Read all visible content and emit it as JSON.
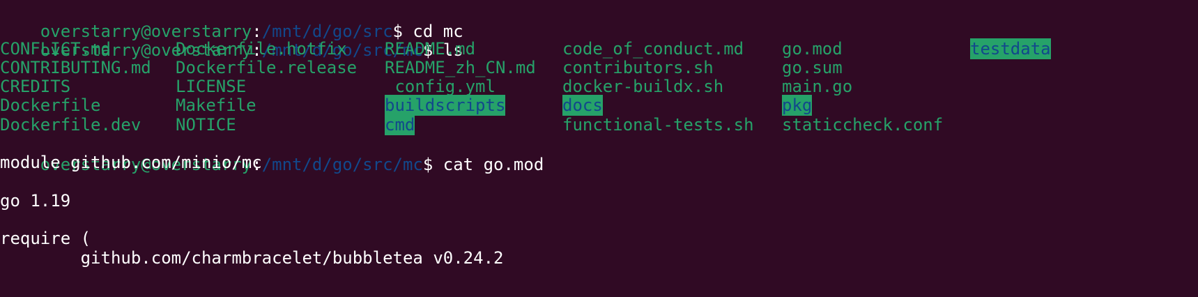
{
  "prompt": {
    "user_host": "overstarry@overstarry",
    "separator": ":",
    "dollar": "$"
  },
  "commands": [
    {
      "path": "/mnt/d/go/src",
      "command": " cd mc"
    },
    {
      "path": "/mnt/d/go/src/mc",
      "command": " ls"
    },
    {
      "path": "/mnt/d/go/src/mc",
      "command": " cat go.mod"
    }
  ],
  "ls_columns": [
    {
      "items": [
        {
          "name": "CONFLICT.md",
          "type": "file"
        },
        {
          "name": "CONTRIBUTING.md",
          "type": "file"
        },
        {
          "name": "CREDITS",
          "type": "file"
        },
        {
          "name": "Dockerfile",
          "type": "file"
        },
        {
          "name": "Dockerfile.dev",
          "type": "file"
        }
      ]
    },
    {
      "items": [
        {
          "name": "Dockerfile.hotfix",
          "type": "file"
        },
        {
          "name": "Dockerfile.release",
          "type": "file"
        },
        {
          "name": "LICENSE",
          "type": "file"
        },
        {
          "name": "Makefile",
          "type": "file"
        },
        {
          "name": "NOTICE",
          "type": "file"
        }
      ]
    },
    {
      "items": [
        {
          "name": "README.md",
          "type": "file"
        },
        {
          "name": "README_zh_CN.md",
          "type": "file"
        },
        {
          "name": "_config.yml",
          "type": "file"
        },
        {
          "name": "buildscripts",
          "type": "dir"
        },
        {
          "name": "cmd",
          "type": "dir"
        }
      ]
    },
    {
      "items": [
        {
          "name": "code_of_conduct.md",
          "type": "file"
        },
        {
          "name": "contributors.sh",
          "type": "file"
        },
        {
          "name": "docker-buildx.sh",
          "type": "file"
        },
        {
          "name": "docs",
          "type": "dir"
        },
        {
          "name": "functional-tests.sh",
          "type": "file"
        }
      ]
    },
    {
      "items": [
        {
          "name": "go.mod",
          "type": "file"
        },
        {
          "name": "go.sum",
          "type": "file"
        },
        {
          "name": "main.go",
          "type": "file"
        },
        {
          "name": "pkg",
          "type": "dir"
        },
        {
          "name": "staticcheck.conf",
          "type": "file"
        }
      ]
    },
    {
      "items": [
        {
          "name": "testdata",
          "type": "dir"
        }
      ]
    }
  ],
  "gomod_lines": [
    "module github.com/minio/mc",
    "",
    "go 1.19",
    "",
    "require (",
    "        github.com/charmbracelet/bubbletea v0.24.2"
  ],
  "colors": {
    "background": "#300a24",
    "user": "#26a269",
    "path": "#12488b",
    "text": "#ffffff",
    "dir_bg": "#26a269"
  }
}
